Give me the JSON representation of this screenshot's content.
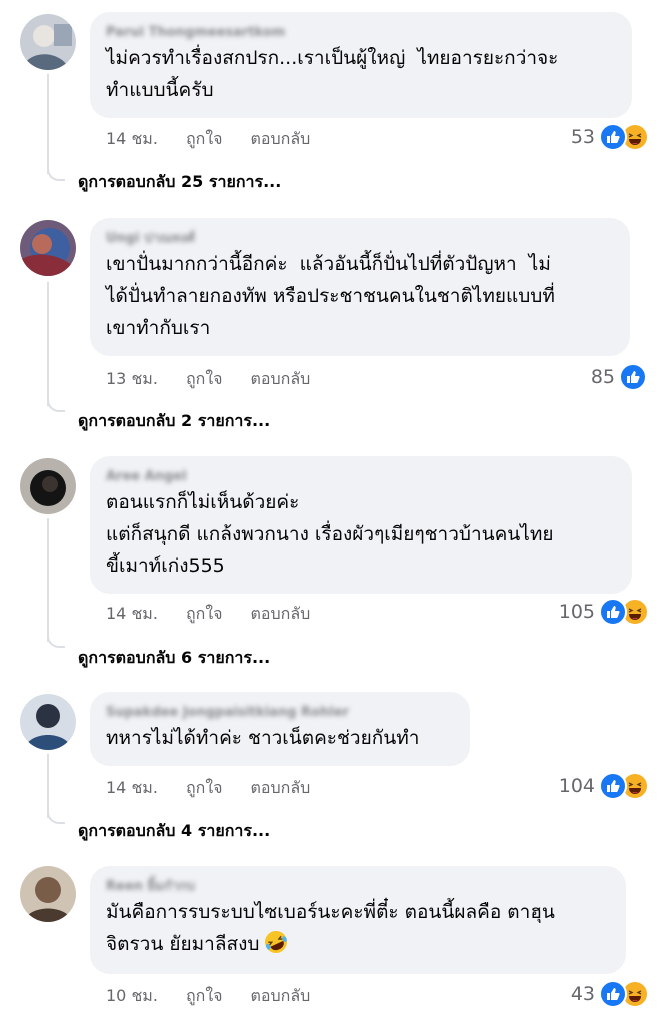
{
  "comments": [
    {
      "author": "Parui Thongmeesartkom",
      "lines": [
        "ไม่ควรทำเรื่องสกปรก...เราเป็นผู้ใหญ่  ไทยอารยะกว่าจะ",
        "ทำแบบนี้ครับ"
      ],
      "time": "14 ชม.",
      "like": "ถูกใจ",
      "reply": "ตอบกลับ",
      "count": "53",
      "reactions": [
        "like-icon",
        "haha-icon"
      ],
      "view_replies": "ดูการตอบกลับ 25 รายการ..."
    },
    {
      "author": "Ungi ปาณทงศ์",
      "lines": [
        "เขาปั่นมากกว่านี้อีกค่ะ  แล้วอันนี้ก็ปั่นไปที่ตัวปัญหา  ไม่",
        "ได้ปั่นทำลายกองทัพ หรือประชาชนคนในชาติไทยแบบที่",
        "เขาทำกับเรา"
      ],
      "time": "13 ชม.",
      "like": "ถูกใจ",
      "reply": "ตอบกลับ",
      "count": "85",
      "reactions": [
        "like-icon"
      ],
      "view_replies": "ดูการตอบกลับ 2 รายการ..."
    },
    {
      "author": "Aree Angel",
      "lines": [
        "ตอนแรกก็ไม่เห็นด้วยค่ะ",
        "แต่ก็สนุกดี แกล้งพวกนาง เรื่องผัวๆเมียๆชาวบ้านคนไทย",
        "ขี้เมาท์เก่ง555"
      ],
      "time": "14 ชม.",
      "like": "ถูกใจ",
      "reply": "ตอบกลับ",
      "count": "105",
      "reactions": [
        "like-icon",
        "haha-icon"
      ],
      "view_replies": "ดูการตอบกลับ 6 รายการ..."
    },
    {
      "author": "Supakdee Jongpaisitkiang Rohler",
      "lines": [
        "ทหารไม่ได้ทำค่ะ ชาวเน็ตคะช่วยกันทำ"
      ],
      "time": "14 ชม.",
      "like": "ถูกใจ",
      "reply": "ตอบกลับ",
      "count": "104",
      "reactions": [
        "like-icon",
        "haha-icon"
      ],
      "view_replies": "ดูการตอบกลับ 4 รายการ..."
    },
    {
      "author": "Reen ยิ้มกำกบ",
      "lines": [
        "มันคือการรบระบบไซเบอร์นะคะพี่ตี๋ะ ตอนนี้ผลคือ ตาฮุน",
        "จิตรวน ยัยมาลีสงบ"
      ],
      "time": "10 ชม.",
      "like": "ถูกใจ",
      "reply": "ตอบกลับ",
      "count": "43",
      "reactions": [
        "like-icon",
        "haha-icon"
      ]
    }
  ],
  "colors": {
    "bubble": "#f0f2f5",
    "meta_text": "#65676b",
    "like_blue": "#1877f2",
    "haha_yellow": "#f7b125"
  }
}
